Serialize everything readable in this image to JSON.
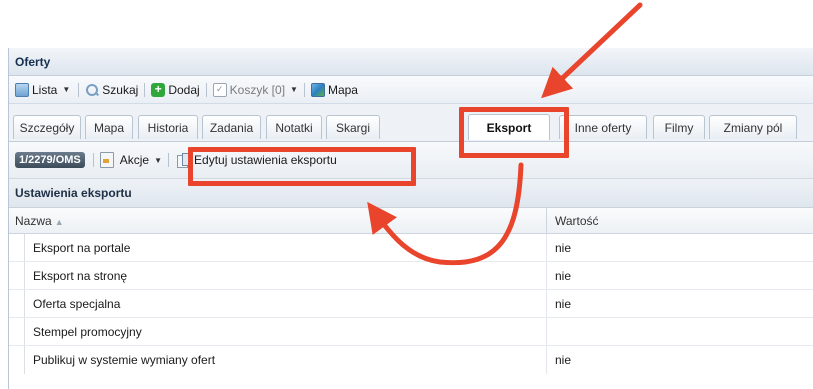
{
  "window": {
    "title": "Oferty"
  },
  "toolbar": {
    "list_label": "Lista",
    "search_label": "Szukaj",
    "add_label": "Dodaj",
    "cart_label": "Koszyk [0]",
    "map_label": "Mapa",
    "icons": [
      "list-icon",
      "search-icon",
      "add-icon",
      "cart-checkbox-icon",
      "map-icon"
    ]
  },
  "tabs": [
    {
      "label": "Szczegóły"
    },
    {
      "label": "Mapa"
    },
    {
      "label": "Historia"
    },
    {
      "label": "Zadania"
    },
    {
      "label": "Notatki"
    },
    {
      "label": "Skargi"
    },
    {
      "label": "Eksport",
      "active": true
    },
    {
      "label": "Inne oferty"
    },
    {
      "label": "Filmy"
    },
    {
      "label": "Zmiany pól"
    }
  ],
  "subbar": {
    "record_id": "1/2279/OMS",
    "actions_label": "Akcje",
    "edit_export_label": "Edytuj ustawienia eksportu"
  },
  "section": {
    "title": "Ustawienia eksportu"
  },
  "table": {
    "headers": {
      "name": "Nazwa",
      "value": "Wartość"
    },
    "rows": [
      {
        "name": "Eksport na portale",
        "value": "nie"
      },
      {
        "name": "Eksport na stronę",
        "value": "nie"
      },
      {
        "name": "Oferta specjalna",
        "value": "nie"
      },
      {
        "name": "Stempel promocyjny",
        "value": ""
      },
      {
        "name": "Publikuj w systemie wymiany ofert",
        "value": "nie"
      }
    ]
  },
  "annotations": {
    "color": "#e8452c"
  }
}
